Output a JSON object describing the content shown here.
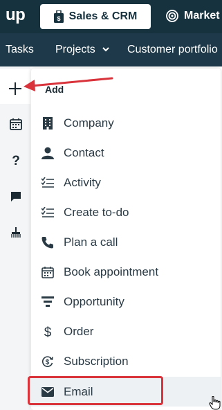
{
  "header": {
    "logo": "up",
    "app_tab_label": "Sales & CRM",
    "market_label": "Market"
  },
  "subnav": {
    "tasks": "Tasks",
    "projects": "Projects",
    "customer": "Customer portfolio"
  },
  "menu": {
    "header": "Add",
    "items": [
      {
        "label": "Company",
        "icon": "building-icon"
      },
      {
        "label": "Contact",
        "icon": "person-icon"
      },
      {
        "label": "Activity",
        "icon": "checklist-icon"
      },
      {
        "label": "Create to-do",
        "icon": "checklist-icon"
      },
      {
        "label": "Plan a call",
        "icon": "phone-icon"
      },
      {
        "label": "Book appointment",
        "icon": "calendar-icon"
      },
      {
        "label": "Opportunity",
        "icon": "funnel-icon"
      },
      {
        "label": "Order",
        "icon": "dollar-icon"
      },
      {
        "label": "Subscription",
        "icon": "subscription-icon"
      },
      {
        "label": "Email",
        "icon": "envelope-icon"
      }
    ]
  },
  "colors": {
    "header_bg": "#17323f",
    "subnav_bg": "#1e3a4a",
    "annotation_red": "#d9343c"
  }
}
